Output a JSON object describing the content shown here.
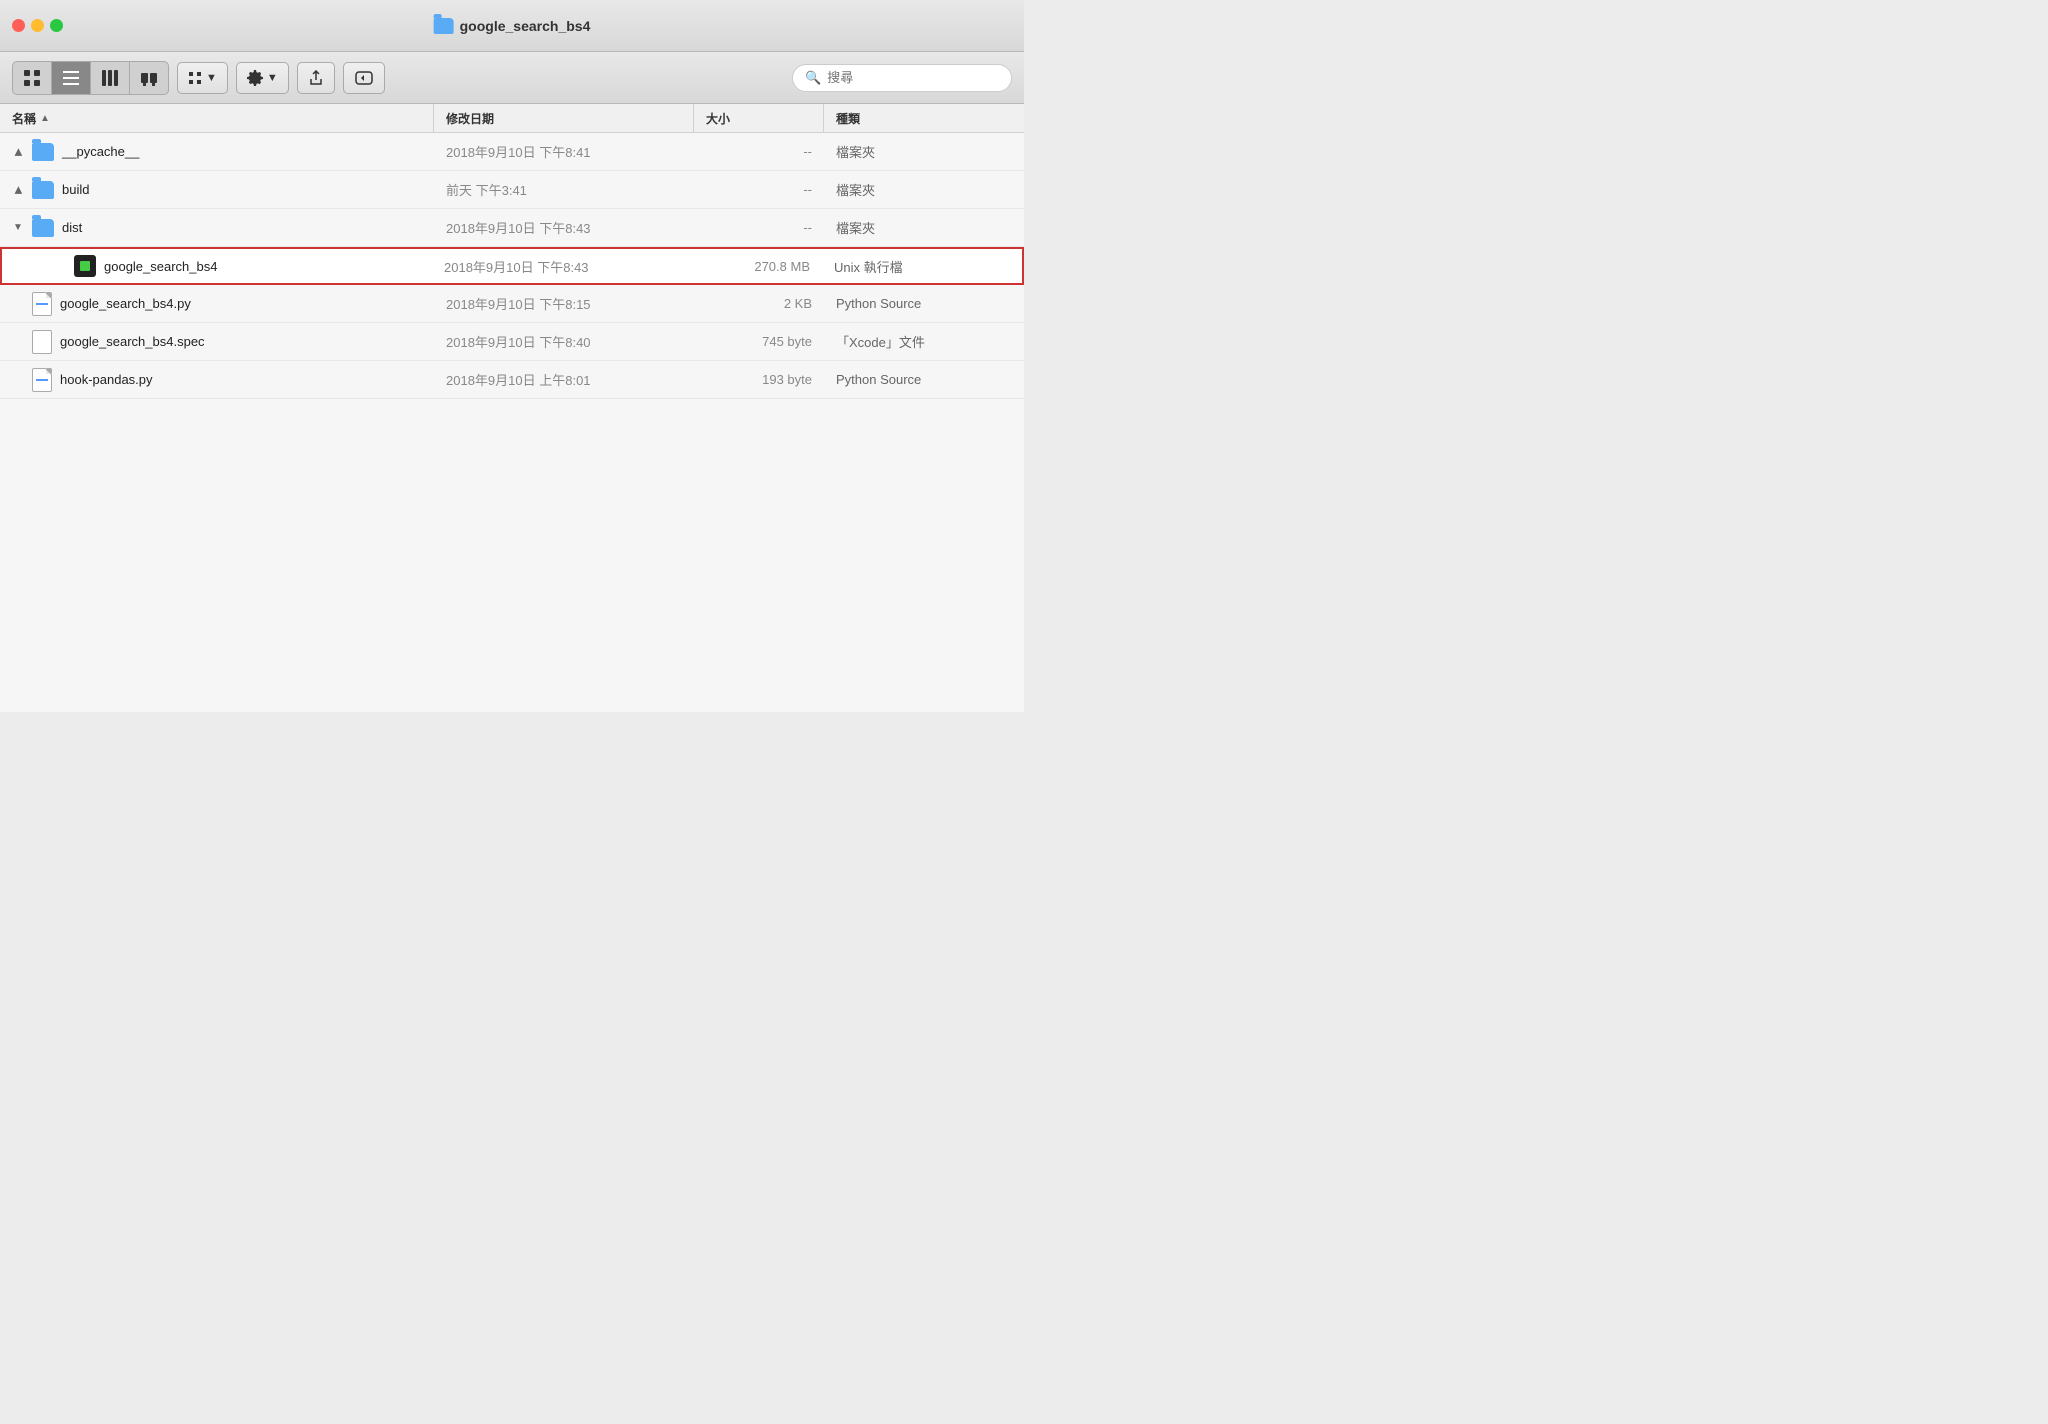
{
  "window": {
    "title": "google_search_bs4"
  },
  "toolbar": {
    "view_modes": [
      "icon-view",
      "list-view",
      "column-view",
      "gallery-view"
    ],
    "active_mode": "list-view",
    "search_placeholder": "搜尋"
  },
  "columns": {
    "name": "名稱",
    "date": "修改日期",
    "size": "大小",
    "kind": "種類"
  },
  "files": [
    {
      "name": "__pycache__",
      "type": "folder",
      "date": "2018年9月10日 下午8:41",
      "size": "--",
      "kind": "檔案夾",
      "indent": 0,
      "expanded": false
    },
    {
      "name": "build",
      "type": "folder",
      "date": "前天 下午3:41",
      "size": "--",
      "kind": "檔案夾",
      "indent": 0,
      "expanded": false
    },
    {
      "name": "dist",
      "type": "folder",
      "date": "2018年9月10日 下午8:43",
      "size": "--",
      "kind": "檔案夾",
      "indent": 0,
      "expanded": true
    },
    {
      "name": "google_search_bs4",
      "type": "executable",
      "date": "2018年9月10日 下午8:43",
      "size": "270.8 MB",
      "kind": "Unix 執行檔",
      "indent": 1,
      "highlighted": true
    },
    {
      "name": "google_search_bs4.py",
      "type": "python",
      "date": "2018年9月10日 下午8:15",
      "size": "2 KB",
      "kind": "Python Source",
      "indent": 0
    },
    {
      "name": "google_search_bs4.spec",
      "type": "spec",
      "date": "2018年9月10日 下午8:40",
      "size": "745 byte",
      "kind": "「Xcode」文件",
      "indent": 0
    },
    {
      "name": "hook-pandas.py",
      "type": "python",
      "date": "2018年9月10日 上午8:01",
      "size": "193 byte",
      "kind": "Python Source",
      "indent": 0
    }
  ]
}
